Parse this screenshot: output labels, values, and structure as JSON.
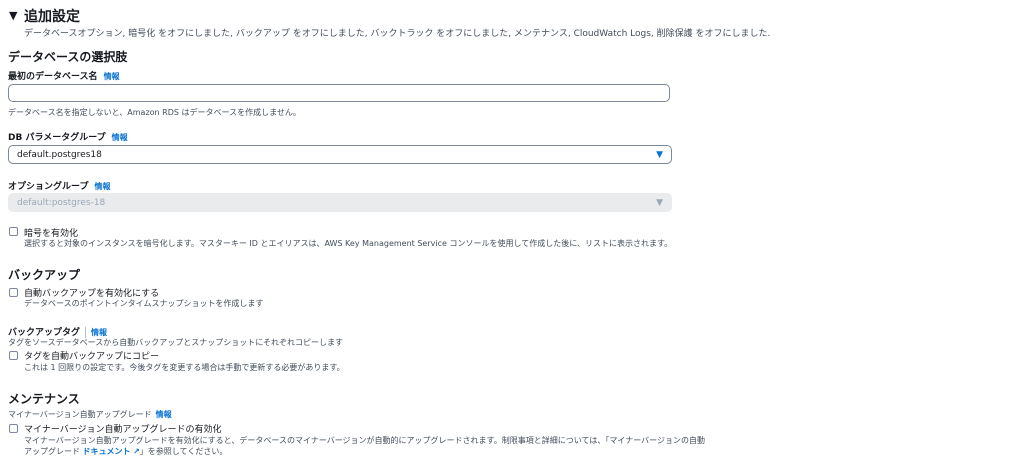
{
  "additional": {
    "arrow": "▼",
    "title": "追加設定",
    "description": "データベースオプション, 暗号化 をオフにしました, バックアップ をオフにしました, バックトラック をオフにしました, メンテナンス, CloudWatch Logs, 削除保護 をオフにしました."
  },
  "db_options": {
    "heading": "データベースの選択肢",
    "initial_db_name": {
      "label": "最初のデータベース名",
      "info": "情報",
      "value": "",
      "hint": "データベース名を指定しないと、Amazon RDS はデータベースを作成しません。"
    },
    "param_group": {
      "label": "DB パラメータグループ",
      "info": "情報",
      "value": "default.postgres18",
      "caret": "▼"
    },
    "option_group": {
      "label": "オプショングループ",
      "info": "情報",
      "value": "default:postgres-18",
      "caret": "▼"
    },
    "encryption": {
      "label": "暗号を有効化",
      "hint": "選択すると対象のインスタンスを暗号化します。マスターキー ID とエイリアスは、AWS Key Management Service コンソールを使用して作成した後に、リストに表示されます。"
    }
  },
  "backup": {
    "heading": "バックアップ",
    "auto_backup": {
      "label": "自動バックアップを有効化にする",
      "hint": "データベースのポイントインタイムスナップショットを作成します"
    },
    "backup_tag": {
      "label": "バックアップタグ",
      "info": "情報",
      "description": "タグをソースデータベースから自動バックアップとスナップショットにそれぞれコピーします",
      "copy_label": "タグを自動バックアップにコピー",
      "copy_hint": "これは 1 回限りの設定です。今後タグを変更する場合は手動で更新する必要があります。"
    }
  },
  "maintenance": {
    "heading": "メンテナンス",
    "subheading": "マイナーバージョン自動アップグレード",
    "info": "情報",
    "auto_minor": {
      "label": "マイナーバージョン自動アップグレードの有効化",
      "hint_line1": "マイナーバージョン自動アップグレードを有効化にすると、データベースのマイナーバージョンが自動的にアップグレードされます。制限事項と詳細については、「マイナーバージョンの自動",
      "hint_line2_prefix": "アップグレード",
      "doc_link": "ドキュメント",
      "external_icon": "↗",
      "hint_line2_suffix": "」を参照してください。"
    }
  }
}
